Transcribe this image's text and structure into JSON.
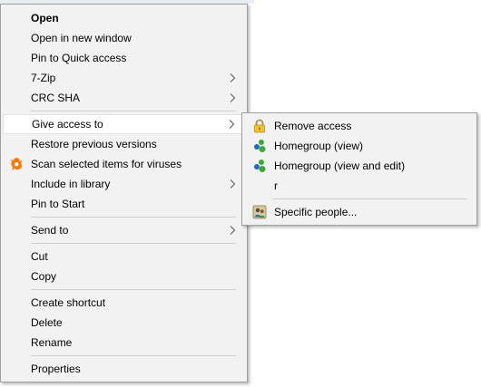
{
  "main_menu": {
    "items": [
      {
        "label": "Open"
      },
      {
        "label": "Open in new window"
      },
      {
        "label": "Pin to Quick access"
      },
      {
        "label": "7-Zip"
      },
      {
        "label": "CRC SHA"
      },
      {
        "label": "Give access to"
      },
      {
        "label": "Restore previous versions"
      },
      {
        "label": "Scan selected items for viruses",
        "icon": "avast-icon"
      },
      {
        "label": "Include in library"
      },
      {
        "label": "Pin to Start"
      },
      {
        "label": "Send to"
      },
      {
        "label": "Cut"
      },
      {
        "label": "Copy"
      },
      {
        "label": "Create shortcut"
      },
      {
        "label": "Delete"
      },
      {
        "label": "Rename"
      },
      {
        "label": "Properties"
      }
    ],
    "highlighted": "Give access to"
  },
  "sub_menu": {
    "items": [
      {
        "label": "Remove access",
        "icon": "lock-icon"
      },
      {
        "label": "Homegroup (view)",
        "icon": "homegroup-icon"
      },
      {
        "label": "Homegroup (view and edit)",
        "icon": "homegroup-icon"
      },
      {
        "label": "r"
      },
      {
        "label": "Specific people...",
        "icon": "people-icon"
      }
    ]
  },
  "colors": {
    "menu_bg": "#f2f2f2",
    "highlight_bg": "#ffffff",
    "avast_orange": "#ff7800",
    "homegroup_green": "#3aa83a",
    "homegroup_blue": "#1e6bb8"
  }
}
